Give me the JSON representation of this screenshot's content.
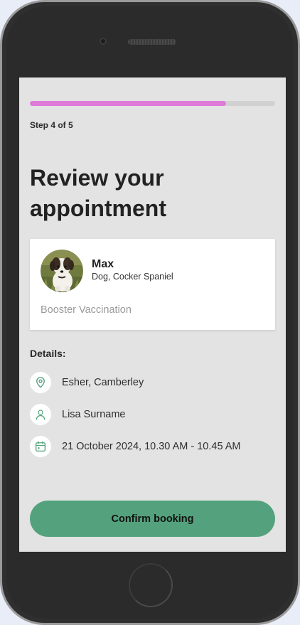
{
  "progress": {
    "fraction": 0.8,
    "fill_color": "#e07ad9",
    "track_color": "#d1d1d1"
  },
  "step": {
    "label": "Step 4 of 5"
  },
  "page": {
    "title": "Review your appointment"
  },
  "pet": {
    "name": "Max",
    "breed": "Dog, Cocker Spaniel",
    "service": "Booster Vaccination",
    "avatar": "dog-photo"
  },
  "details": {
    "heading": "Details:",
    "items": [
      {
        "icon": "location-pin-icon",
        "text": "Esher, Camberley"
      },
      {
        "icon": "person-icon",
        "text": "Lisa Surname"
      },
      {
        "icon": "calendar-icon",
        "text": "21 October 2024, 10.30 AM - 10.45 AM"
      }
    ],
    "icon_color": "#53a27d"
  },
  "actions": {
    "confirm_label": "Confirm booking",
    "confirm_color": "#53a27d"
  }
}
